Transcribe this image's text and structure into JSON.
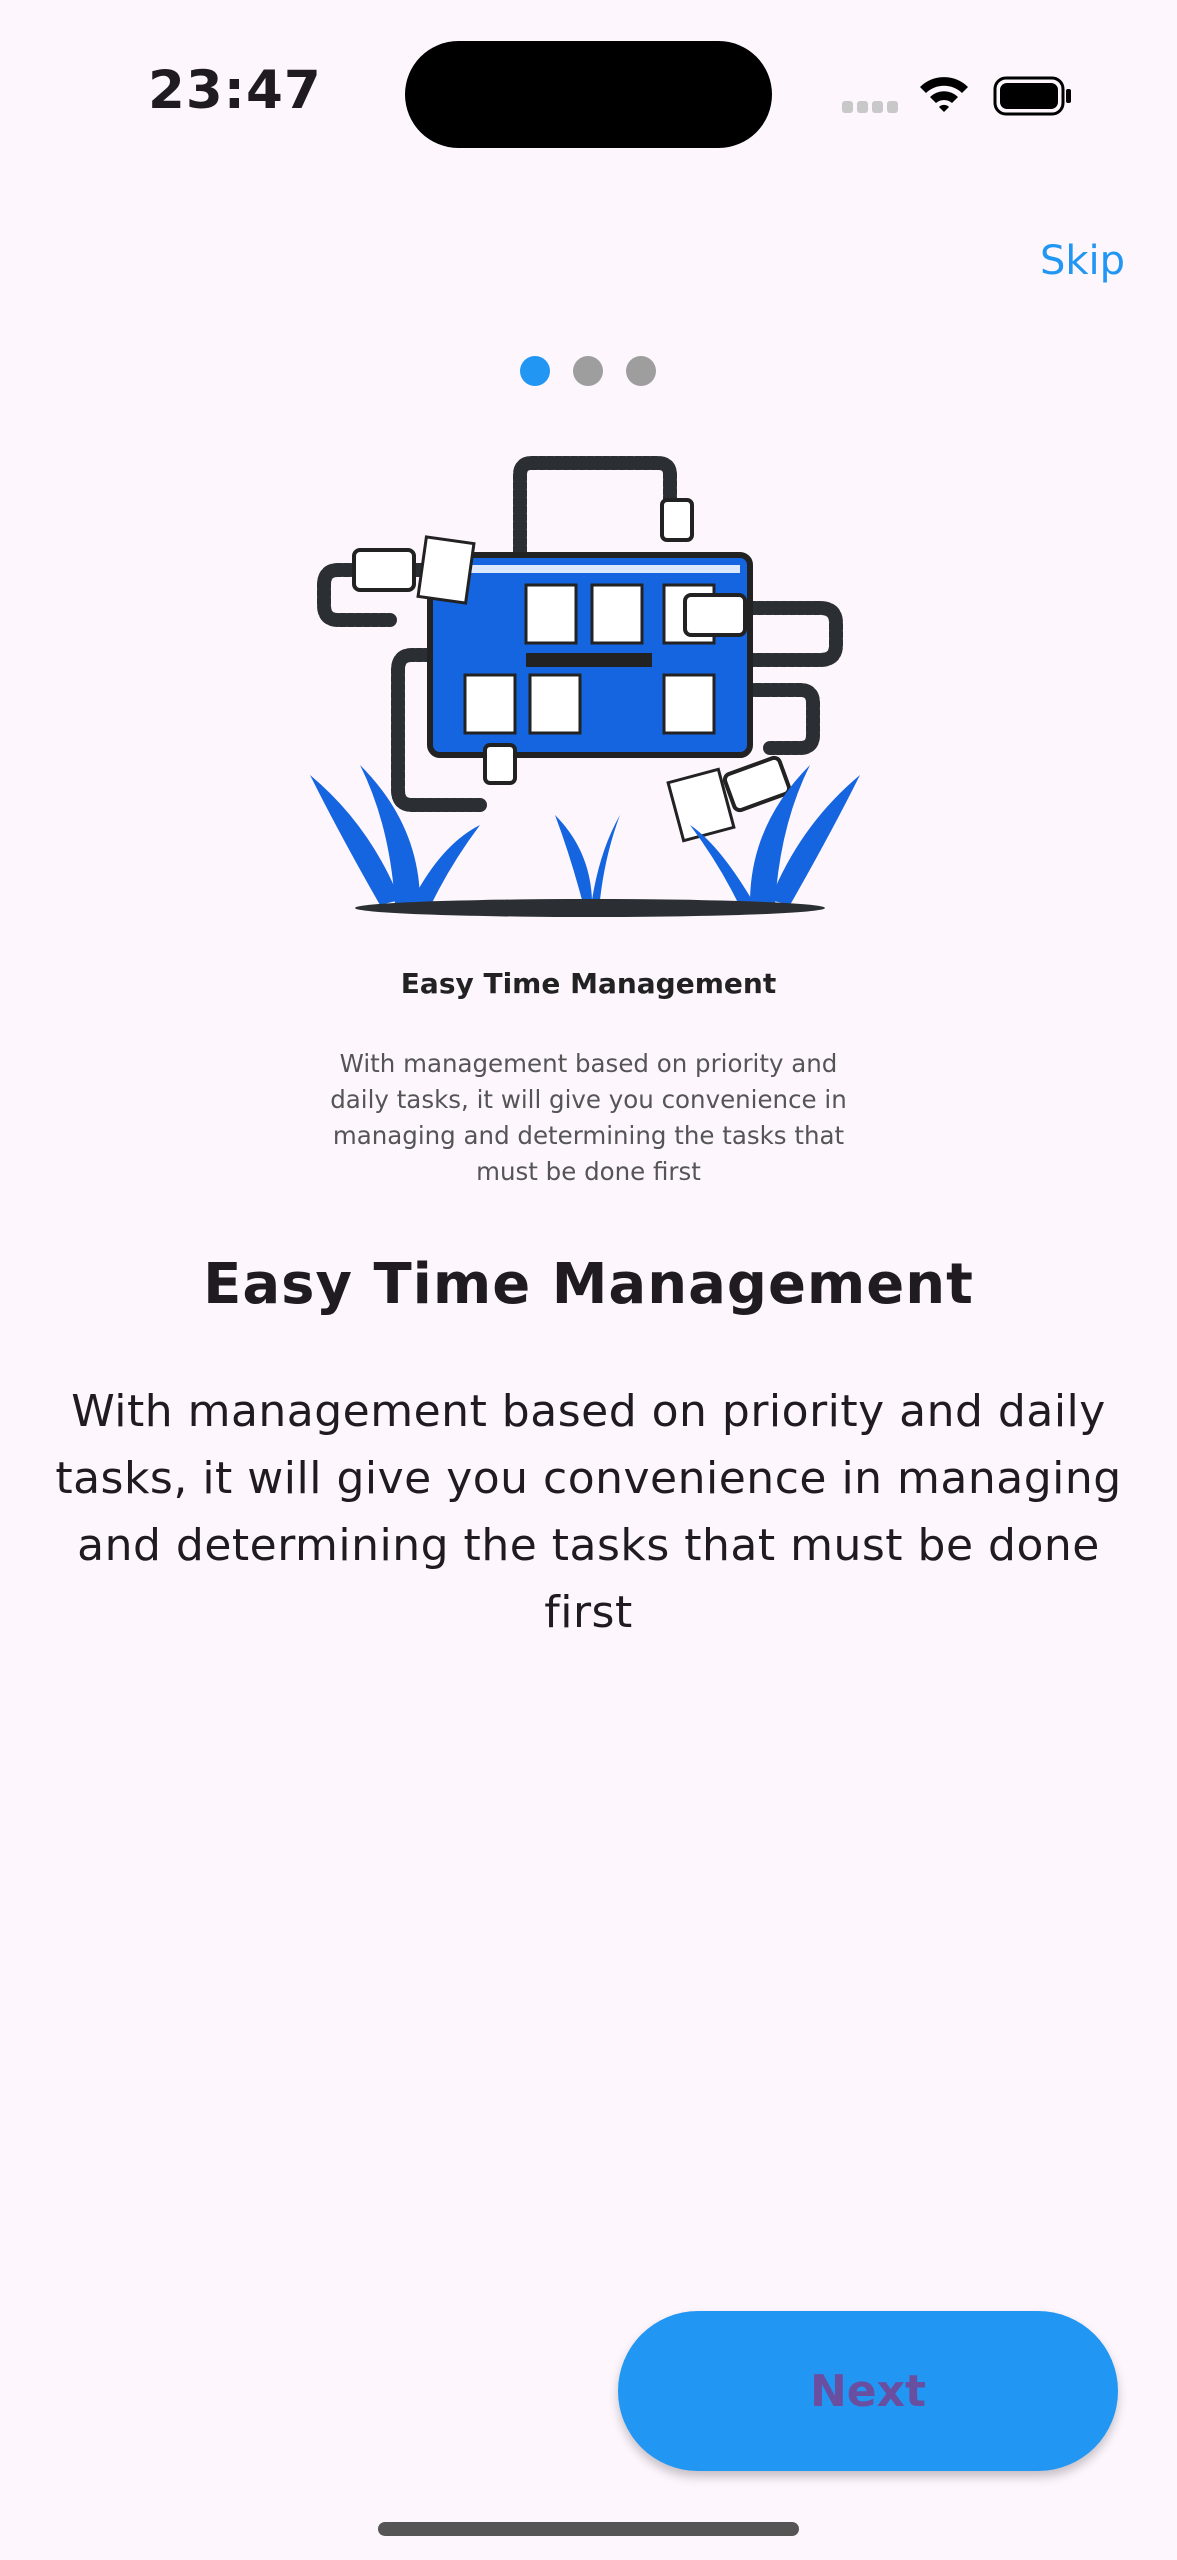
{
  "status_bar": {
    "time": "23:47",
    "icons": [
      "signal-icon",
      "wifi-icon",
      "battery-icon"
    ]
  },
  "header": {
    "skip_label": "Skip"
  },
  "pager": {
    "page_count": 3,
    "current_page": 1
  },
  "illustration": {
    "title": "Easy Time Management",
    "description": "With management based on priority and daily tasks, it will give you convenience in managing and determining the tasks that must be done first"
  },
  "content": {
    "title": "Easy Time Management",
    "description": "With management based on priority and daily tasks, it will give you convenience in managing and determining the tasks that must be done first"
  },
  "footer": {
    "next_label": "Next"
  },
  "colors": {
    "accent": "#2196f3",
    "background": "#fdf6fd",
    "inactive_dot": "#9e9e9e",
    "button_text": "#6a4fa0"
  }
}
